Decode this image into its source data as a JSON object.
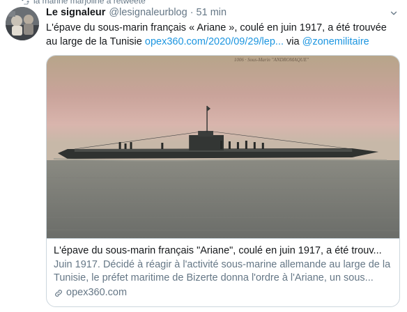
{
  "retweet": {
    "text": "la marine marjoline a retweeté",
    "icon": "retweet-icon"
  },
  "tweet": {
    "avatar_icon": "avatar",
    "display_name": "Le signaleur",
    "handle": "@lesignaleurblog",
    "separator": "·",
    "time": "51 min",
    "text_before_link": "L'épave du sous-marin français « Ariane », coulé en juin 1917, a été trouvée au large de la Tunisie ",
    "link_text": "opex360.com/2020/09/29/lep...",
    "via_text": " via ",
    "mention": "@zonemilitaire",
    "caret_icon": "chevron-down-icon"
  },
  "card": {
    "image_caption": "1006 · Sous-Marin \"ANDROMAQUE\"",
    "title": "L'épave du sous-marin français \"Ariane\", coulé en juin 1917, a été trouv...",
    "description": "Juin 1917. Décidé à réagir à l'activité sous-marine allemande au large de la Tunisie, le préfet maritime de Bizerte donna l'ordre à l'Ariane, un sous...",
    "domain": "opex360.com",
    "domain_icon": "link-icon"
  },
  "colors": {
    "link": "#1b95e0",
    "muted": "#657786",
    "border": "#ccd6dd",
    "text": "#14171a"
  }
}
